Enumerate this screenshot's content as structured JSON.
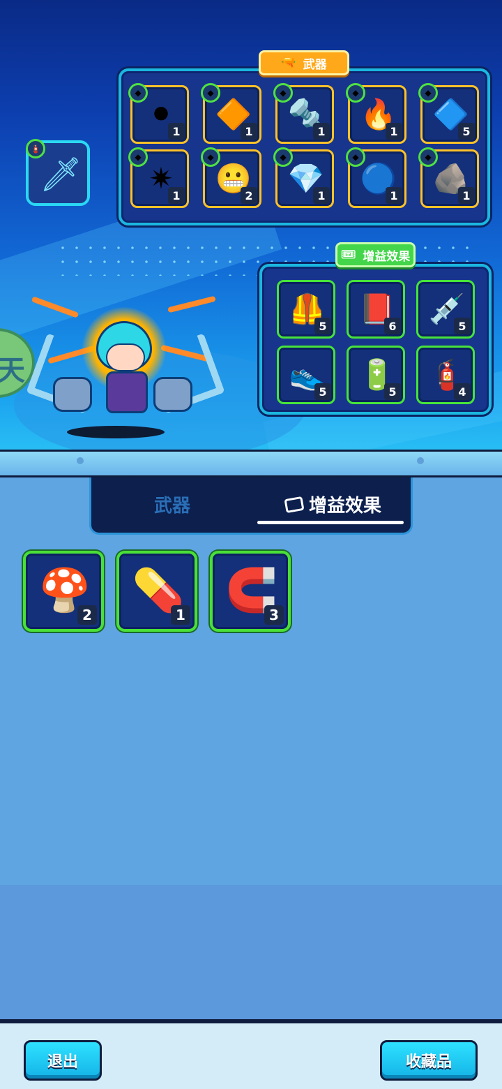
{
  "top": {
    "weapon_tag": "武器",
    "buff_tag": "增益效果",
    "equipped_weapon_icon": "kunai-icon",
    "weapon_slots": [
      {
        "icon": "tire-icon",
        "glyph": "⚫",
        "count": "1"
      },
      {
        "icon": "golden-crystal-tower-icon",
        "glyph": "🔶",
        "count": "1"
      },
      {
        "icon": "drill-screw-icon",
        "glyph": "🔩",
        "count": "1"
      },
      {
        "icon": "fireball-icon",
        "glyph": "🔥",
        "count": "1"
      },
      {
        "icon": "laser-wand-icon",
        "glyph": "🔷",
        "count": "5"
      },
      {
        "icon": "spiked-ball-icon",
        "glyph": "✷",
        "count": "1"
      },
      {
        "icon": "chattering-teeth-icon",
        "glyph": "😬",
        "count": "2"
      },
      {
        "icon": "purple-crystal-icon",
        "glyph": "💎",
        "count": "1"
      },
      {
        "icon": "energy-orb-icon",
        "glyph": "🔵",
        "count": "1"
      },
      {
        "icon": "rock-icon",
        "glyph": "🪨",
        "count": "1"
      }
    ],
    "buff_slots": [
      {
        "icon": "vest-icon",
        "glyph": "🦺",
        "count": "5"
      },
      {
        "icon": "red-book-icon",
        "glyph": "📕",
        "count": "6"
      },
      {
        "icon": "syringe-icon",
        "glyph": "💉",
        "count": "5"
      },
      {
        "icon": "sneaker-icon",
        "glyph": "👟",
        "count": "5"
      },
      {
        "icon": "energy-canister-icon",
        "glyph": "🔋",
        "count": "5"
      },
      {
        "icon": "fuel-can-icon",
        "glyph": "🧯",
        "count": "4"
      }
    ]
  },
  "tabs": {
    "weapons": "武器",
    "buffs": "增益效果"
  },
  "inventory": [
    {
      "icon": "mushroom-icon",
      "glyph": "🍄",
      "count": "2"
    },
    {
      "icon": "capsule-pill-icon",
      "glyph": "💊",
      "count": "1"
    },
    {
      "icon": "magnet-icon",
      "glyph": "🧲",
      "count": "3"
    }
  ],
  "bottom": {
    "exit_label": "退出",
    "collection_label": "收藏品"
  },
  "colors": {
    "weapon_slot_border": "#ffc229",
    "buff_slot_border": "#47e33a",
    "button_cyan": "#2ee1ff"
  }
}
